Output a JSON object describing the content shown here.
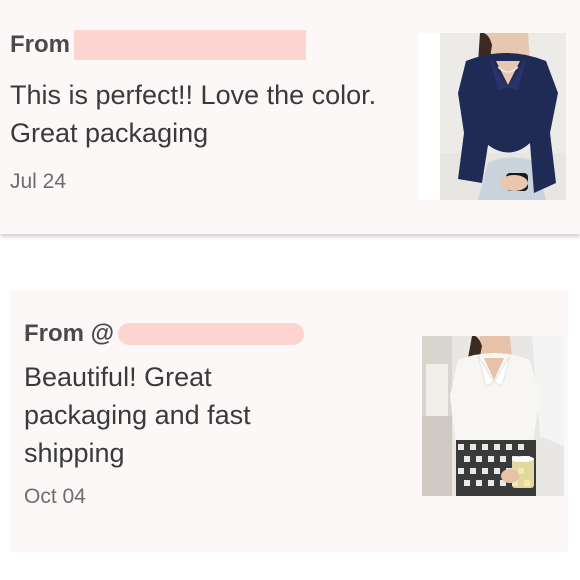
{
  "reviews": [
    {
      "from_label": "From",
      "text": "This is perfect!! Love the color. Great packaging",
      "date": "Jul 24",
      "photo_icon": "navy-polo-top-photo"
    },
    {
      "from_label": "From @",
      "text": "Beautiful! Great packaging and fast shipping",
      "date": "Oct 04",
      "photo_icon": "white-polo-top-photo"
    }
  ],
  "colors": {
    "card_background": "#fcf8f8",
    "redaction": "#fdd4d0",
    "text": "#3a3a3a",
    "date": "#6d6d6d"
  }
}
